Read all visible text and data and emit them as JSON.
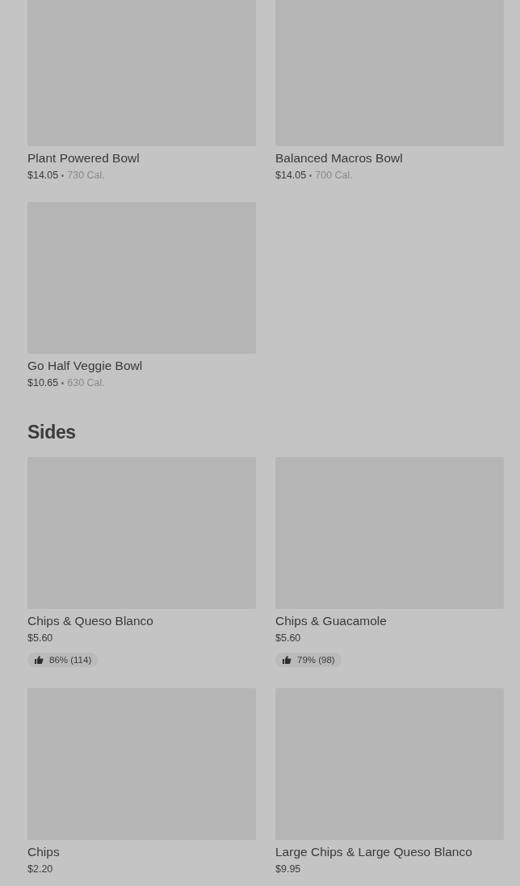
{
  "sections": [
    {
      "items": [
        {
          "name": "Plant Powered Bowl",
          "price": "$14.05",
          "calories": "730 Cal."
        },
        {
          "name": "Balanced Macros Bowl",
          "price": "$14.05",
          "calories": "700 Cal."
        },
        {
          "name": "Go Half Veggie Bowl",
          "price": "$10.65",
          "calories": "630 Cal."
        }
      ]
    },
    {
      "title": "Sides",
      "items": [
        {
          "name": "Chips & Queso Blanco",
          "price": "$5.60",
          "rating": "86% (114)"
        },
        {
          "name": "Chips & Guacamole",
          "price": "$5.60",
          "rating": "79% (98)"
        },
        {
          "name": "Chips",
          "price": "$2.20"
        },
        {
          "name": "Large Chips & Large Queso Blanco",
          "price": "$9.95"
        }
      ]
    }
  ]
}
